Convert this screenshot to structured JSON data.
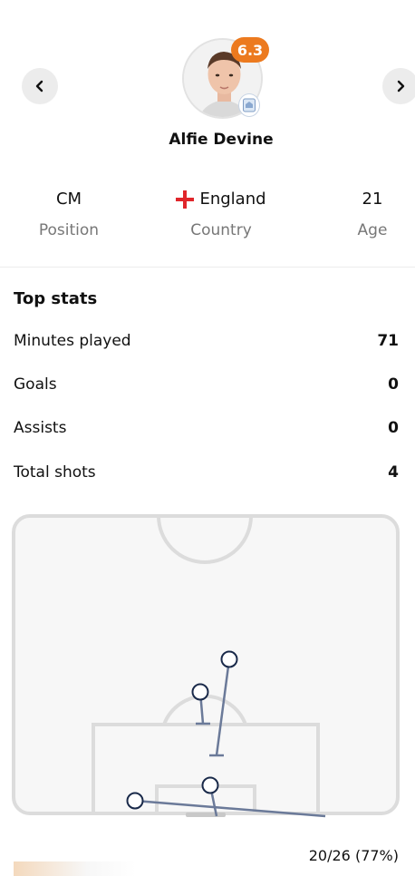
{
  "player": {
    "name": "Alfie Devine",
    "rating": "6.3",
    "club_badge_icon": "club-crest-icon"
  },
  "navigation": {
    "prev_icon": "chevron-left-icon",
    "next_icon": "chevron-right-icon"
  },
  "info": {
    "position": {
      "value": "CM",
      "label": "Position"
    },
    "country": {
      "value": "England",
      "label": "Country",
      "flag_icon": "england-flag-icon"
    },
    "age": {
      "value": "21",
      "label": "Age"
    }
  },
  "top_stats": {
    "title": "Top stats",
    "rows": [
      {
        "label": "Minutes played",
        "value": "71"
      },
      {
        "label": "Goals",
        "value": "0"
      },
      {
        "label": "Assists",
        "value": "0"
      },
      {
        "label": "Total shots",
        "value": "4"
      }
    ]
  },
  "shot_map": {
    "shot_count": 4
  },
  "passes": {
    "summary": "20/26 (77%)"
  },
  "colors": {
    "rating_badge": "#ec7a1f",
    "shot_marker": "#1a2a4a",
    "shot_line": "#6b7a99",
    "pitch_line": "#dcdcdc",
    "flag_red": "#e0262b"
  }
}
